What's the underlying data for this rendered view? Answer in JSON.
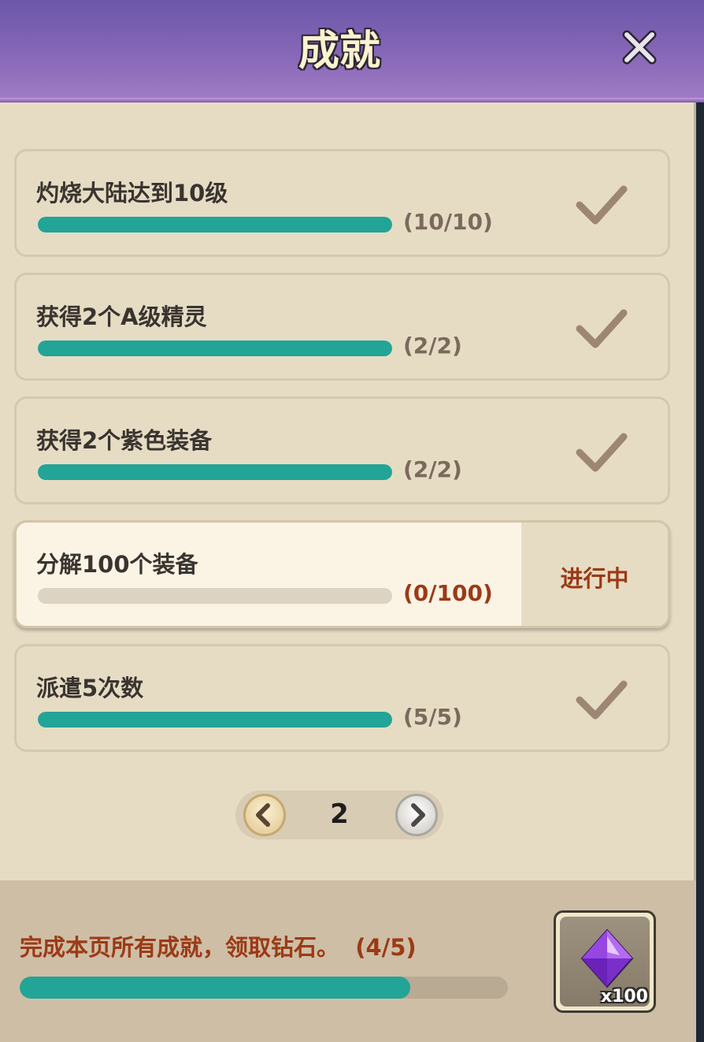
{
  "header": {
    "title": "成就"
  },
  "achievements": [
    {
      "title": "灼烧大陆达到10级",
      "progress_text": "(10/10)",
      "current": 10,
      "target": 10,
      "status": "completed"
    },
    {
      "title": "获得2个A级精灵",
      "progress_text": "(2/2)",
      "current": 2,
      "target": 2,
      "status": "completed"
    },
    {
      "title": "获得2个紫色装备",
      "progress_text": "(2/2)",
      "current": 2,
      "target": 2,
      "status": "completed"
    },
    {
      "title": "分解100个装备",
      "progress_text": "(0/100)",
      "current": 0,
      "target": 100,
      "status": "in_progress",
      "status_label": "进行中"
    },
    {
      "title": "派遣5次数",
      "progress_text": "(5/5)",
      "current": 5,
      "target": 5,
      "status": "completed"
    }
  ],
  "pagination": {
    "page": "2"
  },
  "footer": {
    "text": "完成本页所有成就，领取钻石。  (4/5)",
    "completed": 4,
    "total": 5,
    "reward_qty": "x100",
    "reward_icon": "purple-diamond-icon"
  },
  "colors": {
    "accent": "#22a497",
    "header_purple": "#7f62b3",
    "status_text": "#9b3a16",
    "panel_bg": "#e6dcc4"
  }
}
